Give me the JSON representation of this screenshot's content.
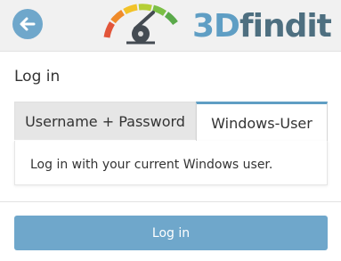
{
  "header": {
    "back_icon": "arrow-left-icon",
    "logo": {
      "prefix": "3D",
      "suffix": "findit"
    }
  },
  "title": "Log in",
  "tabs": [
    {
      "label": "Username + Password",
      "active": false
    },
    {
      "label": "Windows-User",
      "active": true
    }
  ],
  "panel": {
    "text": "Log in with your current Windows user."
  },
  "login_button": {
    "label": "Log in"
  },
  "colors": {
    "accent": "#5f9ec4",
    "button": "#6fa7cb",
    "logo_text": "#4e6f80",
    "header_bg": "#f1f1f1"
  }
}
